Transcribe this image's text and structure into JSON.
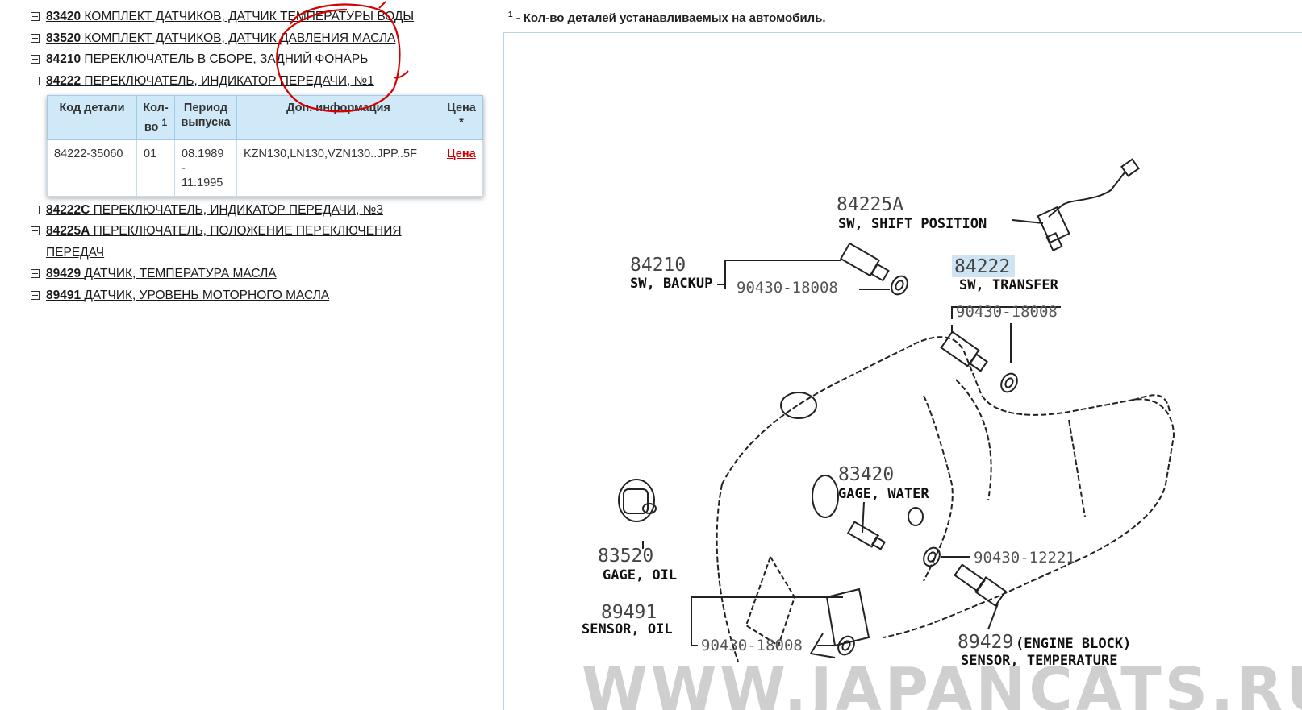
{
  "tree": [
    {
      "code": "83420",
      "label": "КОМПЛЕКТ ДАТЧИКОВ, ДАТЧИК ТЕМПЕРАТУРЫ ВОДЫ",
      "expanded": false
    },
    {
      "code": "83520",
      "label": "КОМПЛЕКТ ДАТЧИКОВ, ДАТЧИК ДАВЛЕНИЯ МАСЛА",
      "expanded": false
    },
    {
      "code": "84210",
      "label": "ПЕРЕКЛЮЧАТЕЛЬ В СБОРЕ, ЗАДНИЙ ФОНАРЬ",
      "expanded": false
    },
    {
      "code": "84222",
      "label": "ПЕРЕКЛЮЧАТЕЛЬ, ИНДИКАТОР ПЕРЕДАЧИ, №1",
      "expanded": true
    },
    {
      "code": "84222C",
      "label": "ПЕРЕКЛЮЧАТЕЛЬ, ИНДИКАТОР ПЕРЕДАЧИ, №3",
      "expanded": false
    },
    {
      "code": "84225A",
      "label": "ПЕРЕКЛЮЧАТЕЛЬ, ПОЛОЖЕНИЕ ПЕРЕКЛЮЧЕНИЯ ПЕРЕДАЧ",
      "expanded": false
    },
    {
      "code": "89429",
      "label": "ДАТЧИК, ТЕМПЕРАТУРА МАСЛА",
      "expanded": false
    },
    {
      "code": "89491",
      "label": "ДАТЧИК, УРОВЕНЬ МОТОРНОГО МАСЛА",
      "expanded": false
    }
  ],
  "parts_table": {
    "headers": {
      "code": "Код детали",
      "qty": "Кол-во",
      "qty_sup": "1",
      "period": "Период выпуска",
      "info": "Доп. информация",
      "price": "Цена",
      "price_sup": "*"
    },
    "rows": [
      {
        "code": "84222-35060",
        "qty": "01",
        "period": "08.1989 - 11.1995",
        "info": "KZN130,LN130,VZN130..JPP..5F",
        "price": "Цена"
      }
    ]
  },
  "footnote": {
    "sup": "1",
    "text": "- Кол-во деталей устанавливаемых на автомобиль."
  },
  "diagram": {
    "callouts": {
      "c84225a_num": "84225A",
      "c84225a_lbl": "SW, SHIFT POSITION",
      "c84210_num": "84210",
      "c84210_lbl": "SW, BACKUP",
      "c84210_ref": "90430-18008",
      "c84222_num": "84222",
      "c84222_lbl": "SW, TRANSFER",
      "c84222_ref": "90430-18008",
      "c83420_num": "83420",
      "c83420_lbl": "GAGE, WATER",
      "c83520_num": "83520",
      "c83520_lbl": "GAGE, OIL",
      "c90430_12221": "90430-12221",
      "c89491_num": "89491",
      "c89491_lbl": "SENSOR, OIL",
      "c90430_bot": "90430-18008",
      "c89429_num": "89429",
      "c89429_note": "(ENGINE BLOCK)",
      "c89429_lbl": "SENSOR, TEMPERATURE"
    },
    "watermark": "WWW.JAPANCATS.RU",
    "colors": {
      "highlight": "#cfe4f2",
      "annotation": "#d40000",
      "frame": "#b9d3e3",
      "table_header": "#cfe9f9",
      "price_link": "#cc0000"
    }
  }
}
